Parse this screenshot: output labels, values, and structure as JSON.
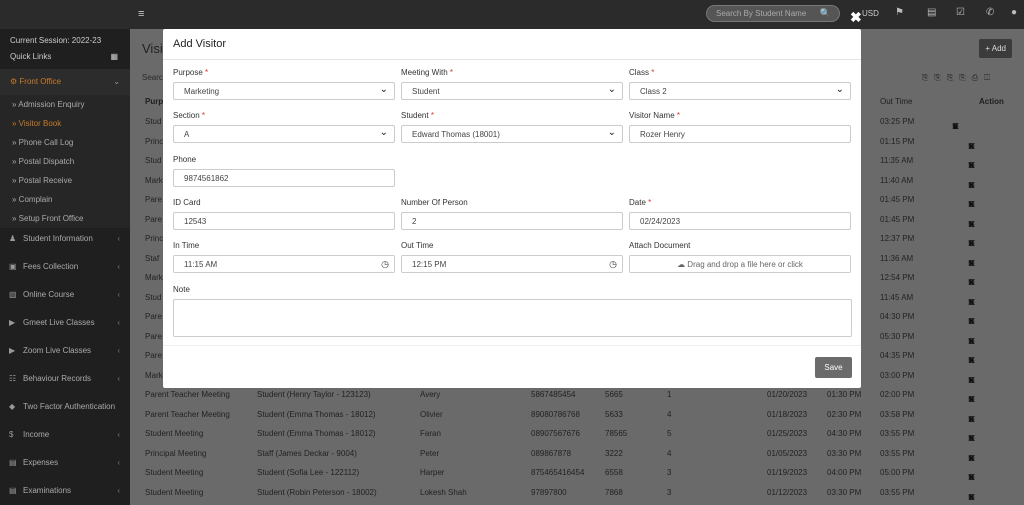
{
  "topbar": {
    "search_placeholder": "Search By Student Name",
    "currency": "USD",
    "menu_glyph": "≡"
  },
  "sidebar": {
    "session": "Current Session: 2022-23",
    "quick_links": "Quick Links",
    "front_office": "Front Office",
    "front_office_items": [
      "» Admission Enquiry",
      "» Visitor Book",
      "» Phone Call Log",
      "» Postal Dispatch",
      "» Postal Receive",
      "» Complain",
      "» Setup Front Office"
    ],
    "items": [
      "Student Information",
      "Fees Collection",
      "Online Course",
      "Gmeet Live Classes",
      "Zoom Live Classes",
      "Behaviour Records",
      "Two Factor Authentication",
      "Income",
      "Expenses",
      "Examinations"
    ]
  },
  "background": {
    "title": "Visi",
    "add_label": "+ Add",
    "search_label": "Searc",
    "col_purpose": "Purp",
    "col_out_time": "Out Time",
    "col_action": "Action",
    "partial_rows": [
      {
        "purpose": "Stud",
        "out": "03:25 PM"
      },
      {
        "purpose": "Princ",
        "out": "01:15 PM"
      },
      {
        "purpose": "Stud",
        "out": "11:35 AM"
      },
      {
        "purpose": "Mark",
        "out": "11:40 AM"
      },
      {
        "purpose": "Pare",
        "out": "01:45 PM"
      },
      {
        "purpose": "Pare",
        "out": "01:45 PM"
      },
      {
        "purpose": "Princ",
        "out": "12:37 PM"
      },
      {
        "purpose": "Staf",
        "out": "11:36 AM"
      },
      {
        "purpose": "Mark",
        "out": "12:54 PM"
      },
      {
        "purpose": "Stud",
        "out": "11:45 AM"
      },
      {
        "purpose": "Pare",
        "out": "04:30 PM"
      },
      {
        "purpose": "Pare",
        "out": "05:30 PM"
      },
      {
        "purpose": "Pare",
        "out": "04:35 PM"
      },
      {
        "purpose": "Mark",
        "out": "03:00 PM"
      }
    ],
    "full_rows": [
      {
        "purpose": "Parent Teacher Meeting",
        "with": "Student (Henry Taylor - 123123)",
        "name": "Avery",
        "phone": "5867485454",
        "id": "5665",
        "num": "1",
        "date": "01/20/2023",
        "in": "01:30 PM",
        "out": "02:00 PM"
      },
      {
        "purpose": "Parent Teacher Meeting",
        "with": "Student (Emma Thomas - 18012)",
        "name": "Olivier",
        "phone": "89080786768",
        "id": "5633",
        "num": "4",
        "date": "01/18/2023",
        "in": "02:30 PM",
        "out": "03:58 PM"
      },
      {
        "purpose": "Student Meeting",
        "with": "Student (Emma Thomas - 18012)",
        "name": "Faran",
        "phone": "08907567676",
        "id": "78565",
        "num": "5",
        "date": "01/25/2023",
        "in": "04:30 PM",
        "out": "03:55 PM"
      },
      {
        "purpose": "Principal Meeting",
        "with": "Staff (James Deckar - 9004)",
        "name": "Peter",
        "phone": "089867878",
        "id": "3222",
        "num": "4",
        "date": "01/05/2023",
        "in": "03:30 PM",
        "out": "03:55 PM"
      },
      {
        "purpose": "Student Meeting",
        "with": "Student (Sofia Lee - 122112)",
        "name": "Harper",
        "phone": "875465416454",
        "id": "6558",
        "num": "3",
        "date": "01/19/2023",
        "in": "04:00 PM",
        "out": "05:00 PM"
      },
      {
        "purpose": "Student Meeting",
        "with": "Student (Robin Peterson - 18002)",
        "name": "Lokesh Shah",
        "phone": "97897800",
        "id": "7868",
        "num": "3",
        "date": "01/12/2023",
        "in": "03:30 PM",
        "out": "03:55 PM"
      }
    ]
  },
  "modal": {
    "title": "Add Visitor",
    "required_mark": "*",
    "purpose": {
      "label": "Purpose",
      "value": "Marketing"
    },
    "meeting_with": {
      "label": "Meeting With",
      "value": "Student"
    },
    "class": {
      "label": "Class",
      "value": "Class 2"
    },
    "section": {
      "label": "Section",
      "value": "A"
    },
    "student": {
      "label": "Student",
      "value": "Edward Thomas (18001)"
    },
    "visitor_name": {
      "label": "Visitor Name",
      "value": "Rozer Henry"
    },
    "phone": {
      "label": "Phone",
      "value": "9874561862"
    },
    "id_card": {
      "label": "ID Card",
      "value": "12543"
    },
    "number_of_person": {
      "label": "Number Of Person",
      "value": "2"
    },
    "date": {
      "label": "Date",
      "value": "02/24/2023"
    },
    "in_time": {
      "label": "In Time",
      "value": "11:15 AM"
    },
    "out_time": {
      "label": "Out Time",
      "value": "12:15 PM"
    },
    "attach": {
      "label": "Attach Document",
      "dropzone_text": "Drag and drop a file here or click"
    },
    "note": {
      "label": "Note",
      "value": ""
    },
    "save_label": "Save",
    "close_glyph": "✖"
  }
}
